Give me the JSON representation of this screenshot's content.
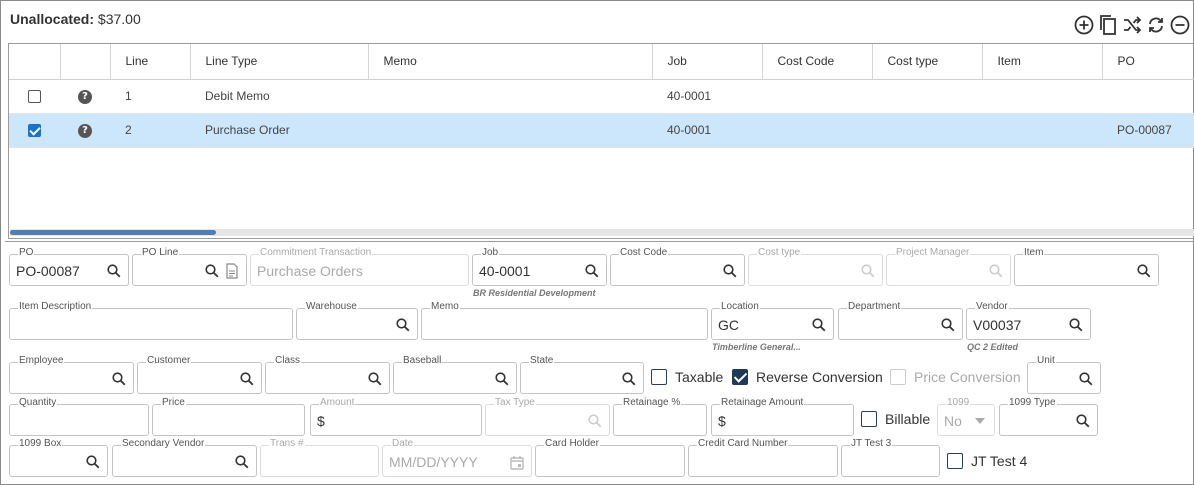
{
  "header": {
    "title_label": "Unallocated:",
    "title_value": "$37.00"
  },
  "toolbar": {
    "icons": [
      "add-circle-icon",
      "copy-icon",
      "split-icon",
      "refresh-icon",
      "remove-circle-icon"
    ]
  },
  "grid": {
    "columns": [
      "",
      "",
      "Line",
      "Line Type",
      "Memo",
      "Job",
      "Cost Code",
      "Cost type",
      "Item",
      "PO"
    ],
    "rows": [
      {
        "checked": false,
        "line": "1",
        "line_type": "Debit Memo",
        "memo": "",
        "job": "40-0001",
        "cost_code": "",
        "cost_type": "",
        "item": "",
        "po": ""
      },
      {
        "checked": true,
        "line": "2",
        "line_type": "Purchase Order",
        "memo": "",
        "job": "40-0001",
        "cost_code": "",
        "cost_type": "",
        "item": "",
        "po": "PO-00087"
      }
    ]
  },
  "form": {
    "po": {
      "label": "PO",
      "value": "PO-00087"
    },
    "po_line": {
      "label": "PO Line",
      "value": ""
    },
    "commitment": {
      "label": "Commitment Transaction",
      "placeholder": "Purchase Orders"
    },
    "job": {
      "label": "Job",
      "value": "40-0001",
      "sub": "BR Residential Development"
    },
    "cost_code": {
      "label": "Cost Code",
      "value": ""
    },
    "cost_type": {
      "label": "Cost type",
      "value": ""
    },
    "project_manager": {
      "label": "Project Manager",
      "value": ""
    },
    "item": {
      "label": "Item",
      "value": ""
    },
    "item_description": {
      "label": "Item Description",
      "value": ""
    },
    "warehouse": {
      "label": "Warehouse",
      "value": ""
    },
    "memo": {
      "label": "Memo",
      "value": ""
    },
    "location": {
      "label": "Location",
      "value": "GC",
      "sub": "Timberline General..."
    },
    "department": {
      "label": "Department",
      "value": ""
    },
    "vendor": {
      "label": "Vendor",
      "value": "V00037",
      "sub": "QC 2 Edited"
    },
    "employee": {
      "label": "Employee",
      "value": ""
    },
    "customer": {
      "label": "Customer",
      "value": ""
    },
    "class": {
      "label": "Class",
      "value": ""
    },
    "baseball": {
      "label": "Baseball",
      "value": ""
    },
    "state": {
      "label": "State",
      "value": ""
    },
    "taxable": {
      "label": "Taxable",
      "checked": false
    },
    "reverse_conversion": {
      "label": "Reverse Conversion",
      "checked": true
    },
    "price_conversion": {
      "label": "Price Conversion",
      "checked": false
    },
    "unit": {
      "label": "Unit",
      "value": ""
    },
    "quantity": {
      "label": "Quantity",
      "value": ""
    },
    "price": {
      "label": "Price",
      "value": ""
    },
    "amount": {
      "label": "Amount",
      "value": "$"
    },
    "tax_type": {
      "label": "Tax Type",
      "value": ""
    },
    "retainage_pct": {
      "label": "Retainage %",
      "value": ""
    },
    "retainage_amount": {
      "label": "Retainage Amount",
      "value": "$"
    },
    "billable": {
      "label": "Billable",
      "checked": false
    },
    "f1099": {
      "label": "1099",
      "value": "No"
    },
    "f1099_type": {
      "label": "1099 Type",
      "value": ""
    },
    "f1099_box": {
      "label": "1099 Box",
      "value": ""
    },
    "secondary_vendor": {
      "label": "Secondary Vendor",
      "value": ""
    },
    "trans_no": {
      "label": "Trans #",
      "value": ""
    },
    "date": {
      "label": "Date",
      "placeholder": "MM/DD/YYYY"
    },
    "card_holder": {
      "label": "Card Holder",
      "value": ""
    },
    "credit_card_number": {
      "label": "Credit Card Number",
      "value": ""
    },
    "jt_test_3": {
      "label": "JT Test 3",
      "value": ""
    },
    "jt_test_4": {
      "label": "JT Test 4",
      "checked": false
    }
  },
  "colors": {
    "selected_row": "#cce6fb",
    "accent": "#1a72c9",
    "checkbox_dark": "#1e3a56"
  }
}
